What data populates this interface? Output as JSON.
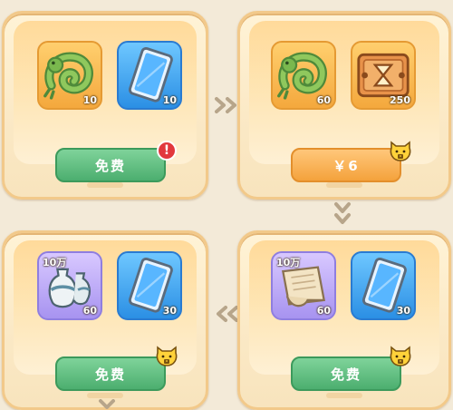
{
  "colors": {
    "green_button": "#4cae6f",
    "orange_button": "#f4a23c",
    "gold_slot": "#f4a83d",
    "blue_slot": "#2b8fe4",
    "purple_slot": "#a793f0",
    "red_badge": "#e2383d"
  },
  "cards": [
    {
      "items": [
        {
          "icon": "jade-dragon-icon",
          "count": "10",
          "tag": ""
        },
        {
          "icon": "blue-card-icon",
          "count": "10",
          "tag": ""
        }
      ],
      "button_label": "免费",
      "badge": "red-exclamation",
      "badge_text": "!"
    },
    {
      "items": [
        {
          "icon": "jade-dragon-icon",
          "count": "60",
          "tag": ""
        },
        {
          "icon": "golden-ticket-icon",
          "count": "250",
          "tag": ""
        }
      ],
      "button_label": "￥6",
      "badge": "cat-lock"
    },
    {
      "items": [
        {
          "icon": "porcelain-vase-icon",
          "count": "60",
          "tag": "10万"
        },
        {
          "icon": "blue-card-icon",
          "count": "30",
          "tag": ""
        }
      ],
      "button_label": "免费",
      "badge": "cat-lock"
    },
    {
      "items": [
        {
          "icon": "scroll-icon",
          "count": "60",
          "tag": "10万"
        },
        {
          "icon": "blue-card-icon",
          "count": "30",
          "tag": ""
        }
      ],
      "button_label": "免费",
      "badge": "cat-lock"
    }
  ]
}
